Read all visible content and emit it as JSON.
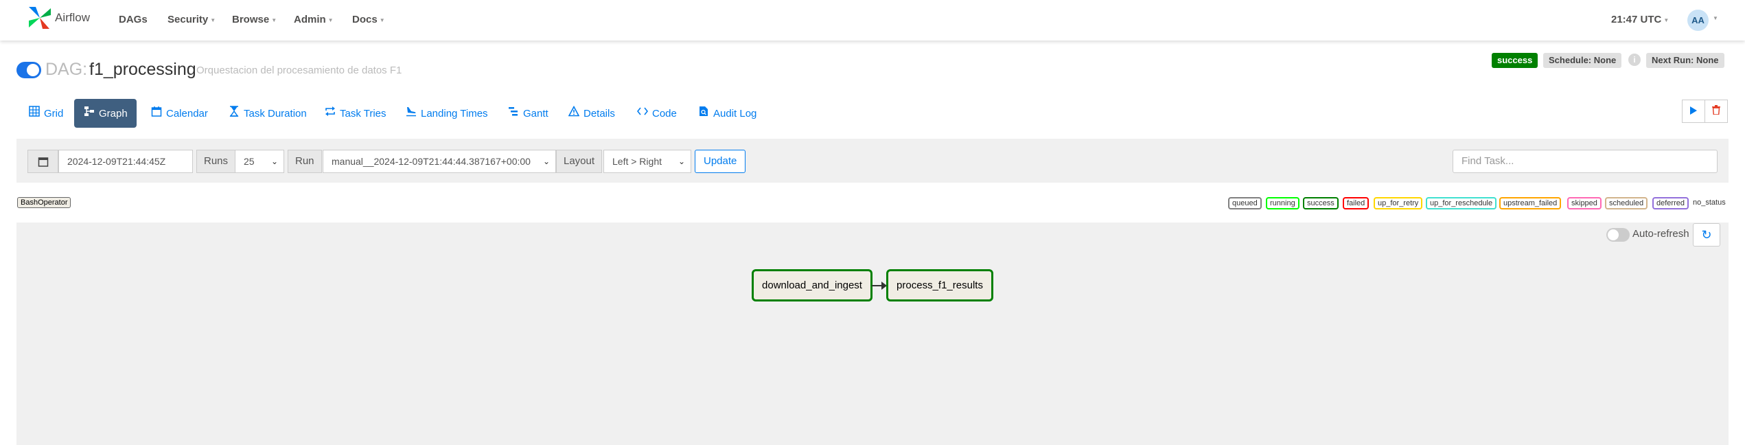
{
  "nav": {
    "brand": "Airflow",
    "items": [
      {
        "label": "DAGs",
        "caret": false
      },
      {
        "label": "Security",
        "caret": true
      },
      {
        "label": "Browse",
        "caret": true
      },
      {
        "label": "Admin",
        "caret": true
      },
      {
        "label": "Docs",
        "caret": true
      }
    ],
    "clock": "21:47 UTC",
    "user_initials": "AA"
  },
  "dag": {
    "label": "DAG:",
    "id": "f1_processing",
    "description": "Orquestacion del procesamiento de datos F1",
    "paused": false,
    "status": "success",
    "schedule": "Schedule: None",
    "next_run": "Next Run: None"
  },
  "tabs": [
    {
      "label": "Grid",
      "icon": "grid-icon"
    },
    {
      "label": "Graph",
      "icon": "graph-icon",
      "active": true
    },
    {
      "label": "Calendar",
      "icon": "calendar-icon"
    },
    {
      "label": "Task Duration",
      "icon": "hourglass-icon"
    },
    {
      "label": "Task Tries",
      "icon": "retry-icon"
    },
    {
      "label": "Landing Times",
      "icon": "plane-landing-icon"
    },
    {
      "label": "Gantt",
      "icon": "gantt-icon"
    },
    {
      "label": "Details",
      "icon": "warning-icon"
    },
    {
      "label": "Code",
      "icon": "code-icon"
    },
    {
      "label": "Audit Log",
      "icon": "audit-log-icon"
    }
  ],
  "filters": {
    "execution_date": "2024-12-09T21:44:45Z",
    "runs_label": "Runs",
    "runs_value": "25",
    "run_label": "Run",
    "run_value": "manual__2024-12-09T21:44:44.387167+00:00",
    "layout_label": "Layout",
    "layout_value": "Left > Right",
    "update_label": "Update",
    "find_task_placeholder": "Find Task..."
  },
  "operators": [
    "BashOperator"
  ],
  "legend": [
    {
      "label": "queued",
      "color": "#808080"
    },
    {
      "label": "running",
      "color": "#00ff00"
    },
    {
      "label": "success",
      "color": "#008000"
    },
    {
      "label": "failed",
      "color": "#ff0000"
    },
    {
      "label": "up_for_retry",
      "color": "#ffd700"
    },
    {
      "label": "up_for_reschedule",
      "color": "#40e0d0"
    },
    {
      "label": "upstream_failed",
      "color": "#ffa500"
    },
    {
      "label": "skipped",
      "color": "#ff69b4"
    },
    {
      "label": "scheduled",
      "color": "#d2b48c"
    },
    {
      "label": "deferred",
      "color": "#9370db"
    },
    {
      "label": "no_status",
      "color": null
    }
  ],
  "graph": {
    "auto_refresh_label": "Auto-refresh",
    "auto_refresh_on": false,
    "nodes": [
      {
        "label": "download_and_ingest",
        "state": "success"
      },
      {
        "label": "process_f1_results",
        "state": "success"
      }
    ]
  }
}
